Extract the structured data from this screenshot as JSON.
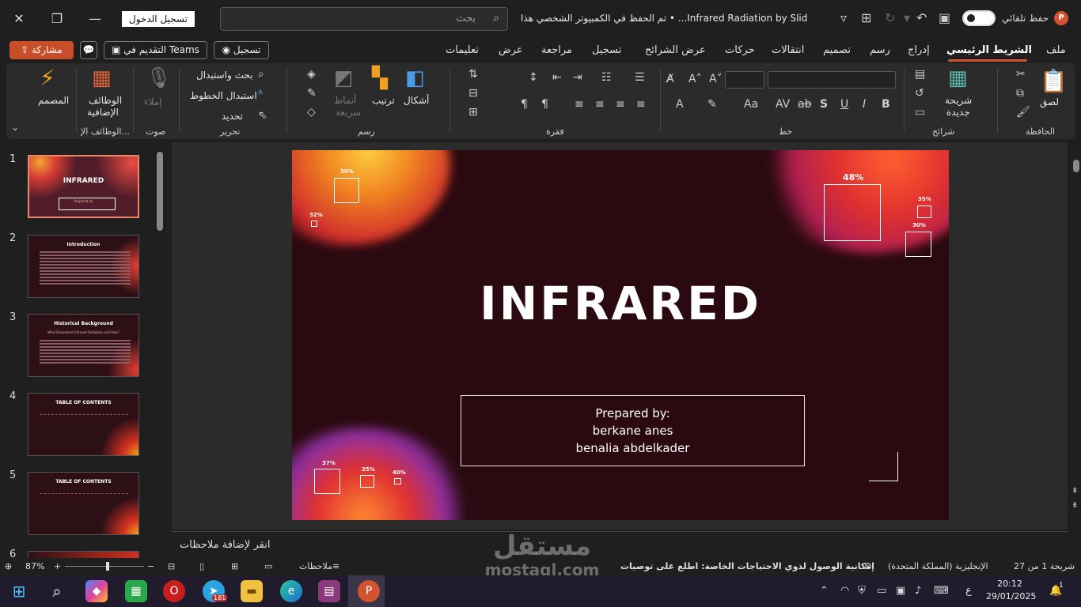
{
  "titlebar": {
    "signin": "تسجيل الدخول",
    "search_placeholder": "بحث",
    "doc_title": "Infrared Radiation by Slid... • تم الحفظ في الكمبيوتر الشخصي هذا",
    "autosave_label": "حفظ تلقائي",
    "app_badge": "P"
  },
  "tabs": {
    "share": "مشاركة",
    "teams": "التقديم في Teams",
    "record": "تسجيل",
    "items": [
      "ملف",
      "الشريط الرئيسي",
      "إدراج",
      "رسم",
      "تصميم",
      "انتقالات",
      "حركات",
      "عرض الشرائح",
      "تسجيل",
      "مراجعة",
      "عرض",
      "تعليمات"
    ]
  },
  "ribbon": {
    "clipboard": {
      "paste": "لصق",
      "group": "الحافظة"
    },
    "slides": {
      "new_slide_1": "شريحة",
      "new_slide_2": "جديدة",
      "group": "شرائح"
    },
    "font": {
      "group": "خط"
    },
    "paragraph": {
      "group": "فقرة"
    },
    "drawing": {
      "shapes": "أشكال",
      "arrange": "ترتيب",
      "quick_styles_1": "أنماط",
      "quick_styles_2": "سريعة",
      "group": "رسم"
    },
    "editing": {
      "find": "بحث واستبدال",
      "replace_fonts": "استبدال الخطوط",
      "select": "تحديد",
      "group": "تحرير"
    },
    "voice": {
      "dictate": "إملاء",
      "group": "صوت"
    },
    "addins": {
      "label_1": "الوظائف",
      "label_2": "الإضافية",
      "group": "الوظائف الإ..."
    },
    "designer": {
      "label": "المصمم"
    }
  },
  "slides": [
    {
      "num": "1",
      "title": "INFRARED",
      "sub": "Prepared by"
    },
    {
      "num": "2",
      "title": "Introduction",
      "sub": ""
    },
    {
      "num": "3",
      "title": "Historical Background",
      "sub": "Who Discovered Infrared Radiation and How?"
    },
    {
      "num": "4",
      "title": "TABLE OF CONTENTS",
      "sub": ""
    },
    {
      "num": "5",
      "title": "TABLE OF CONTENTS",
      "sub": ""
    },
    {
      "num": "6",
      "title": "",
      "sub": ""
    }
  ],
  "main_slide": {
    "title": "INFRARED",
    "prepared_by": "Prepared by:",
    "author_1": "berkane anes",
    "author_2": "benalia abdelkader",
    "percentages": {
      "p48": "48%",
      "p35": "35%",
      "p30_right": "30%",
      "p30_left": "30%",
      "p32": "32%",
      "p37": "37%",
      "p25": "25%",
      "p40": "40%"
    }
  },
  "notes": {
    "placeholder": "انقر لإضافة ملاحظات"
  },
  "statusbar": {
    "slide_info": "شريحة 1 من 27",
    "language": "الإنجليزية (المملكة المتحدة)",
    "accessibility": "إمكانية الوصول لذوي الاحتياجات الخاصة: اطلع على توصيات",
    "notes_btn": "ملاحظات",
    "zoom": "87%"
  },
  "taskbar": {
    "time": "20:12",
    "date": "29/01/2025",
    "lang": "ع",
    "notif_count": "1",
    "telegram_badge": "181"
  },
  "watermark": {
    "text_ar": "مستقل",
    "text_en": "mostaql.com"
  }
}
